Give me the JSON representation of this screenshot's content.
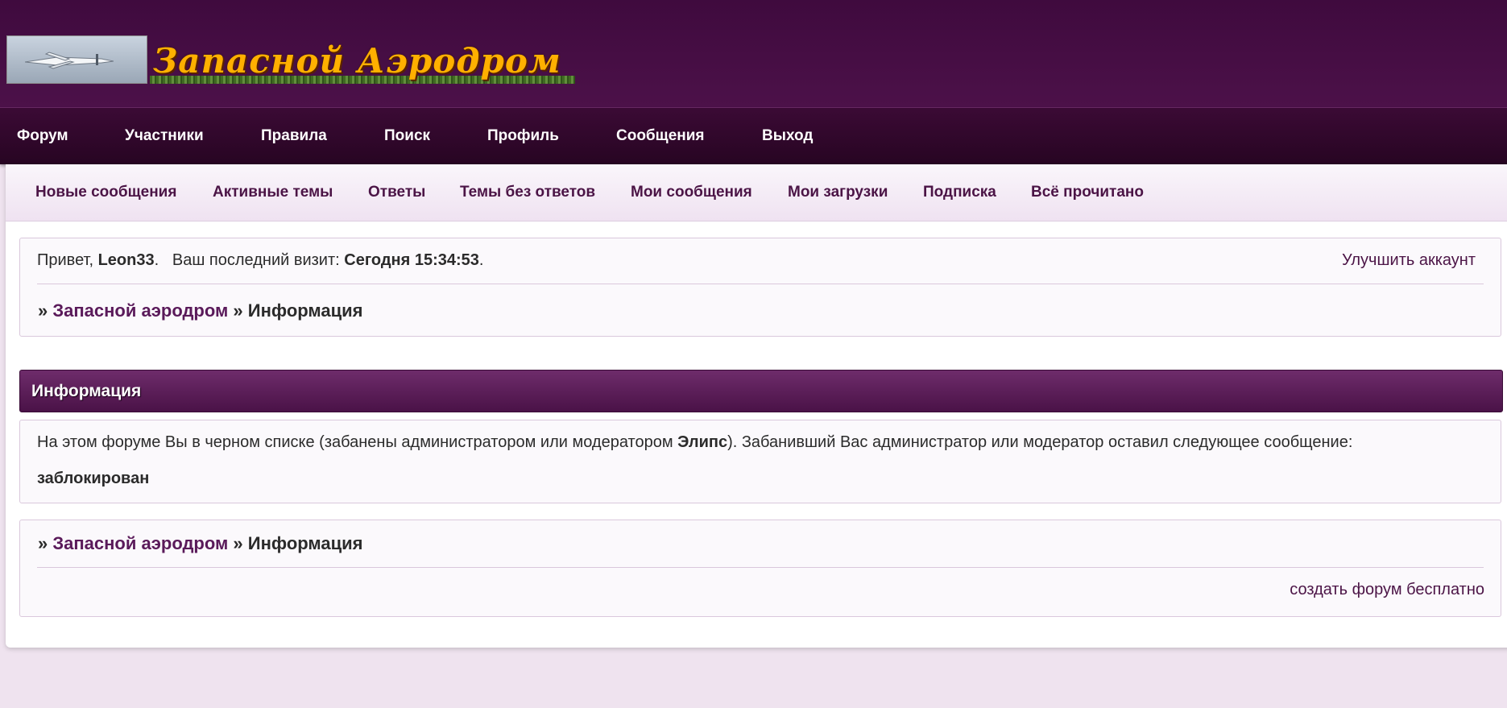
{
  "header": {
    "logo_text": "Запасной Аэродром"
  },
  "main_nav": [
    "Форум",
    "Участники",
    "Правила",
    "Поиск",
    "Профиль",
    "Сообщения",
    "Выход"
  ],
  "sub_nav": [
    "Новые сообщения",
    "Активные темы",
    "Ответы",
    "Темы без ответов",
    "Мои сообщения",
    "Мои загрузки",
    "Подписка",
    "Всё прочитано"
  ],
  "welcome": {
    "greeting": "Привет, ",
    "username": "Leon33",
    "sep": ".   Ваш последний визит: ",
    "last_visit": "Сегодня 15:34:53",
    "end": ".",
    "upgrade_link": "Улучшить аккаунт"
  },
  "breadcrumb": {
    "prefix": "» ",
    "forum": "Запасной аэродром",
    "separator": " » ",
    "current": "Информация"
  },
  "info": {
    "title": "Информация",
    "message_before": "На этом форуме Вы в черном списке (забанены администратором или модератором ",
    "moderator": "Элипс",
    "message_after": "). Забанивший Вас администратор или модератор оставил следующее сообщение:",
    "ban_message": "заблокирован"
  },
  "footer": {
    "create_forum_link": "создать форум бесплатно"
  },
  "colors": {
    "header_bg": "#3f0a3e",
    "accent": "#4b1446",
    "page_bg": "#efe3ef"
  }
}
